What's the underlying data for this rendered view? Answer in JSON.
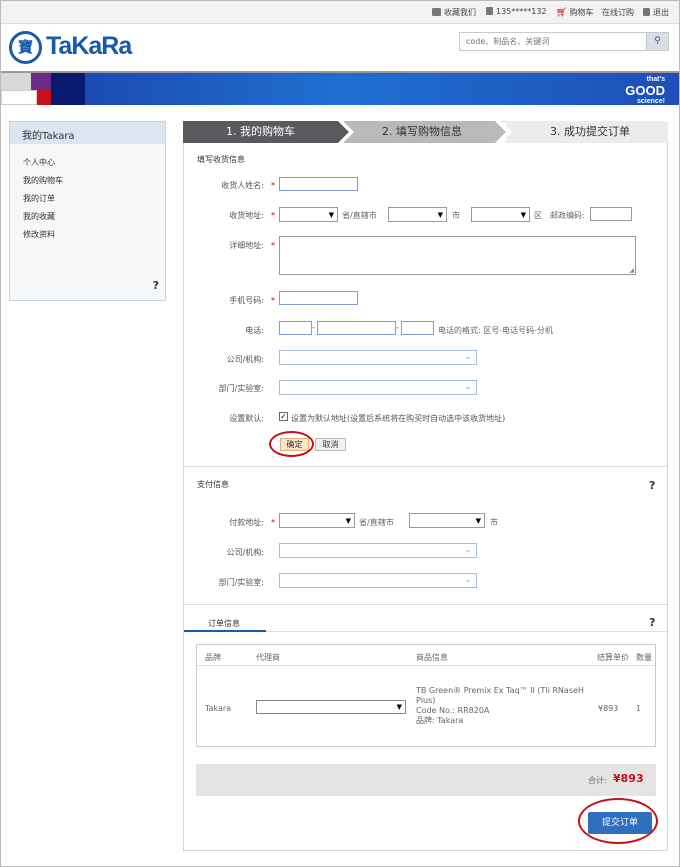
{
  "topbar": {
    "favorite": "收藏我们",
    "phone": "135*****132",
    "cart": "购物车",
    "online_order": "在线订购",
    "logout": "退出"
  },
  "logo": {
    "seal": "寶",
    "brand": "TaKaRa"
  },
  "search": {
    "placeholder": "code、制品名、关键词"
  },
  "banner": {
    "line1": "that's",
    "line2": "GOOD",
    "line3": "science!"
  },
  "sidebar": {
    "title": "我的Takara",
    "items": [
      "个人中心",
      "我的购物车",
      "我的订单",
      "我的收藏",
      "修改资料"
    ],
    "help": "?"
  },
  "steps": [
    "1. 我的购物车",
    "2. 填写购物信息",
    "3. 成功提交订单"
  ],
  "shipping": {
    "section_title": "填写收货信息",
    "name_label": "收货人姓名:",
    "address_label": "收货地址:",
    "province_text": "省/直辖市",
    "city_text": "市",
    "district_text": "区",
    "postcode_label": "邮政编码:",
    "detail_label": "详细地址:",
    "mobile_label": "手机号码:",
    "phone_label": "电话:",
    "phone_hint": "电话的格式: 区号-电话号码-分机",
    "company_label": "公司/机构:",
    "dept_label": "部门/实验室:",
    "default_label": "设置默认:",
    "default_text": "设置为默认地址(设置后系统将在购买时自动选中该收货地址)",
    "confirm": "确定",
    "cancel": "取消"
  },
  "payment": {
    "section_title": "支付信息",
    "help": "?",
    "address_label": "付款地址:",
    "province_text": "省/直辖市",
    "city_text": "市",
    "company_label": "公司/机构:",
    "dept_label": "部门/实验室:"
  },
  "order": {
    "tab": "订单信息",
    "help": "?",
    "headers": [
      "品牌",
      "代理商",
      "商品信息",
      "结算单价",
      "数量"
    ],
    "row": {
      "brand": "Takara",
      "product_line1": "TB Green® Premix Ex Taq™ II (Tli RNaseH",
      "product_line2": "Plus)",
      "product_line3": "Code No.: RR820A",
      "product_line4": "品牌: Takara",
      "price": "¥893",
      "qty": "1"
    },
    "total_label": "合计:",
    "total_value": "¥893",
    "submit": "提交订单"
  },
  "colors": {
    "accent": "#1b5aa8",
    "step_active": "#585a5e",
    "step_inactive": "#b8b9bb",
    "price_red": "#c8101a",
    "submit_blue": "#2f6fbf"
  }
}
